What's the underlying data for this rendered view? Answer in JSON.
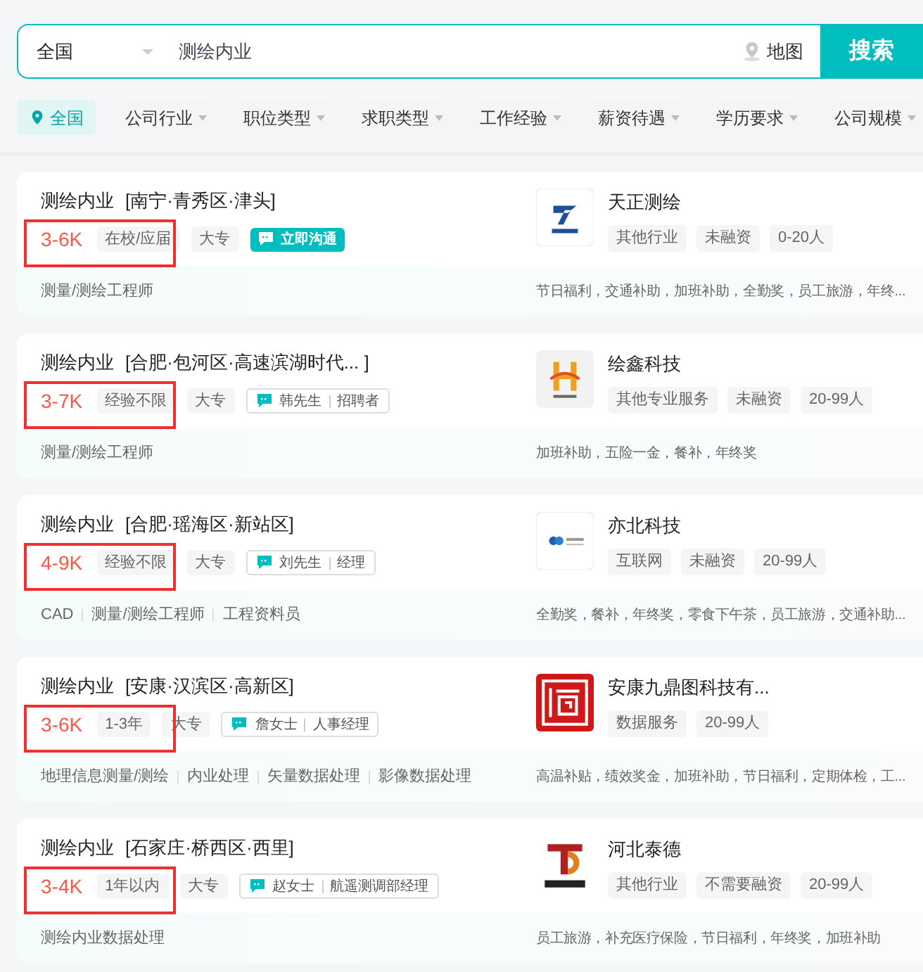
{
  "search": {
    "city": "全国",
    "query": "测绘内业",
    "map_label": "地图",
    "button": "搜索"
  },
  "filters": [
    {
      "label": "全国",
      "selected": true
    },
    {
      "label": "公司行业",
      "selected": false
    },
    {
      "label": "职位类型",
      "selected": false
    },
    {
      "label": "求职类型",
      "selected": false
    },
    {
      "label": "工作经验",
      "selected": false
    },
    {
      "label": "薪资待遇",
      "selected": false
    },
    {
      "label": "学历要求",
      "selected": false
    },
    {
      "label": "公司规模",
      "selected": false
    }
  ],
  "jobs": [
    {
      "title": "测绘内业",
      "location": "[南宁·青秀区·津头]",
      "salary": "3-6K",
      "experience": "在校/应届",
      "education": "大专",
      "highlighted": true,
      "contact": {
        "kind": "chat_now",
        "label": "立即沟通"
      },
      "company": {
        "name": "天正测绘",
        "tags": [
          "其他行业",
          "未融资",
          "0-20人"
        ]
      },
      "skills": [
        "测量/测绘工程师"
      ],
      "benefits": "节日福利，交通补助，加班补助，全勤奖，员工旅游，年终..."
    },
    {
      "title": "测绘内业",
      "location": "[合肥·包河区·高速滨湖时代...  ]",
      "salary": "3-7K",
      "experience": "经验不限",
      "education": "大专",
      "highlighted": true,
      "contact": {
        "kind": "recruiter",
        "name": "韩先生",
        "role": "招聘者"
      },
      "company": {
        "name": "绘鑫科技",
        "tags": [
          "其他专业服务",
          "未融资",
          "20-99人"
        ]
      },
      "skills": [
        "测量/测绘工程师"
      ],
      "benefits": "加班补助，五险一金，餐补，年终奖"
    },
    {
      "title": "测绘内业",
      "location": "[合肥·瑶海区·新站区]",
      "salary": "4-9K",
      "experience": "经验不限",
      "education": "大专",
      "highlighted": true,
      "contact": {
        "kind": "recruiter",
        "name": "刘先生",
        "role": "经理"
      },
      "company": {
        "name": "亦北科技",
        "tags": [
          "互联网",
          "未融资",
          "20-99人"
        ]
      },
      "skills": [
        "CAD",
        "测量/测绘工程师",
        "工程资料员"
      ],
      "benefits": "全勤奖，餐补，年终奖，零食下午茶，员工旅游，交通补助..."
    },
    {
      "title": "测绘内业",
      "location": "[安康·汉滨区·高新区]",
      "salary": "3-6K",
      "experience": "1-3年",
      "education": "大专",
      "highlighted": true,
      "contact": {
        "kind": "recruiter",
        "name": "詹女士",
        "role": "人事经理"
      },
      "company": {
        "name": "安康九鼎图科技有...",
        "tags": [
          "数据服务",
          "20-99人"
        ]
      },
      "skills": [
        "地理信息测量/测绘",
        "内业处理",
        "矢量数据处理",
        "影像数据处理"
      ],
      "benefits": "高温补贴，绩效奖金，加班补助，节日福利，定期体检，工..."
    },
    {
      "title": "测绘内业",
      "location": "[石家庄·桥西区·西里]",
      "salary": "3-4K",
      "experience": "1年以内",
      "education": "大专",
      "highlighted": true,
      "contact": {
        "kind": "recruiter",
        "name": "赵女士",
        "role": "航遥测调部经理"
      },
      "company": {
        "name": "河北泰德",
        "tags": [
          "其他行业",
          "不需要融资",
          "20-99人"
        ]
      },
      "skills": [
        "测绘内业数据处理"
      ],
      "benefits": "员工旅游，补充医疗保险，节日福利，年终奖，加班补助"
    }
  ]
}
